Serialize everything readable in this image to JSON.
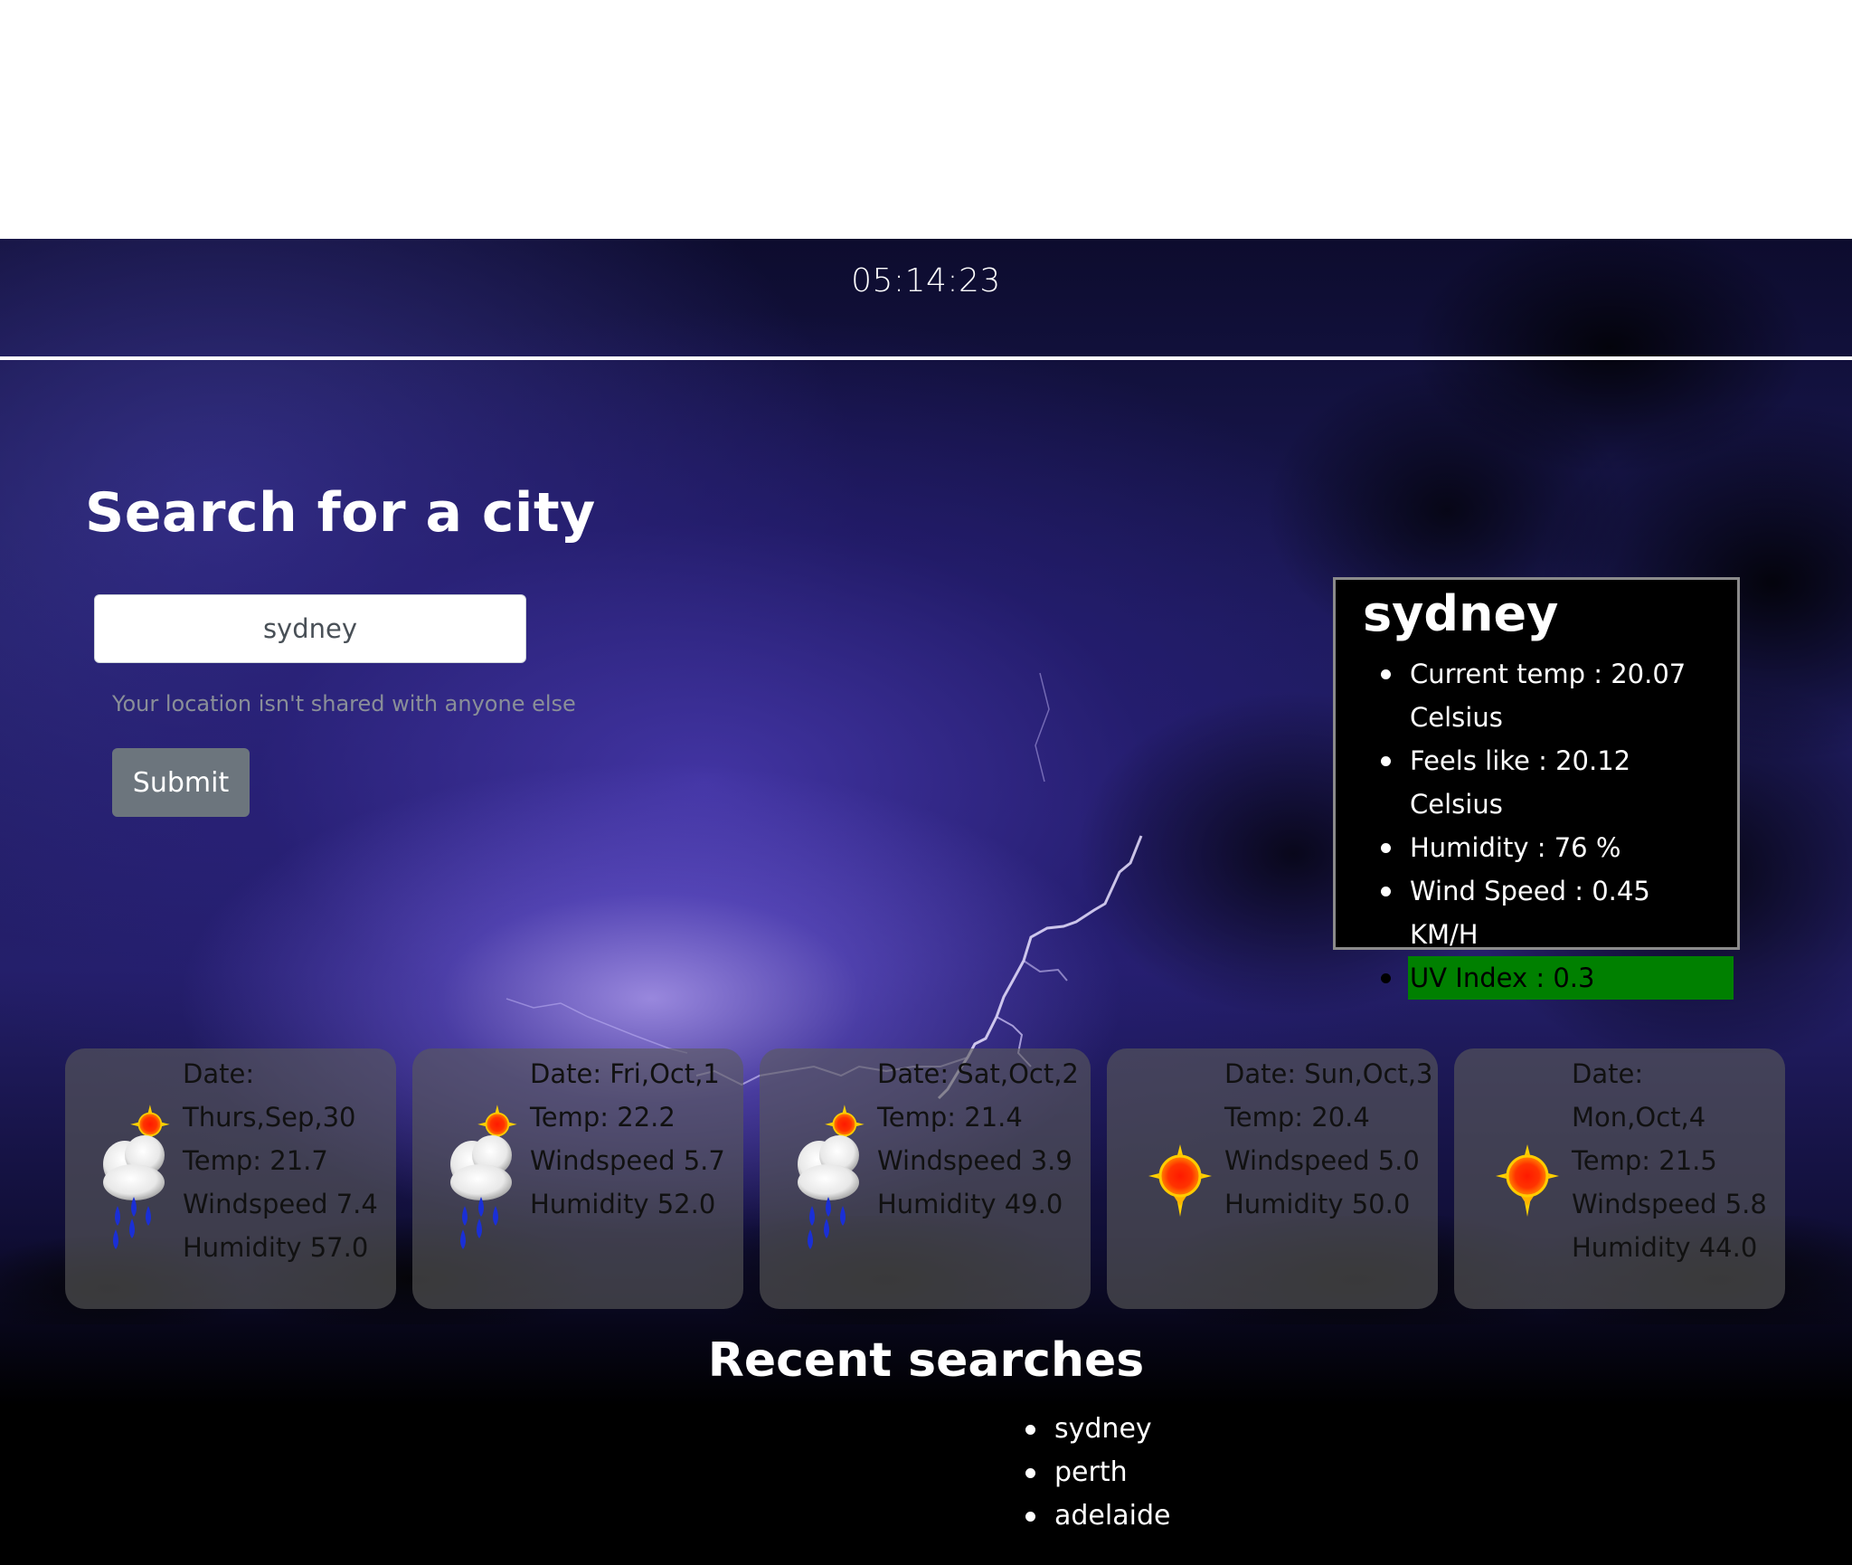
{
  "clock": "05:14:23",
  "search": {
    "title": "Search for a city",
    "input_value": "sydney",
    "help_text": "Your location isn't shared with anyone else",
    "submit_label": "Submit"
  },
  "current": {
    "city": "sydney",
    "current_temp": "Current temp : 20.07 Celsius",
    "feels_like": "Feels like : 20.12 Celsius",
    "humidity": "Humidity : 76 %",
    "wind_speed": "Wind Speed : 0.45 KM/H",
    "uv_index": "UV Index : 0.3",
    "uv_color": "#008000"
  },
  "forecast": [
    {
      "icon": "rain-sun-icon",
      "date": "Date: Thurs,Sep,30",
      "temp": "Temp: 21.7",
      "windspeed": "Windspeed 7.4",
      "humidity": "Humidity 57.0"
    },
    {
      "icon": "rain-sun-icon",
      "date": "Date: Fri,Oct,1",
      "temp": "Temp: 22.2",
      "windspeed": "Windspeed 5.7",
      "humidity": "Humidity 52.0"
    },
    {
      "icon": "rain-sun-icon",
      "date": "Date: Sat,Oct,2",
      "temp": "Temp: 21.4",
      "windspeed": "Windspeed 3.9",
      "humidity": "Humidity 49.0"
    },
    {
      "icon": "sun-icon",
      "date": "Date: Sun,Oct,3",
      "temp": "Temp: 20.4",
      "windspeed": "Windspeed 5.0",
      "humidity": "Humidity 50.0"
    },
    {
      "icon": "sun-icon",
      "date": "Date: Mon,Oct,4",
      "temp": "Temp: 21.5",
      "windspeed": "Windspeed 5.8",
      "humidity": "Humidity 44.0"
    }
  ],
  "recent": {
    "title": "Recent searches",
    "items": [
      "sydney",
      "perth",
      "adelaide"
    ]
  }
}
